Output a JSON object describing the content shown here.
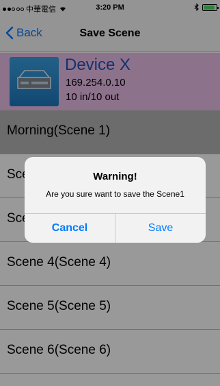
{
  "status_bar": {
    "carrier": "中華電信",
    "time": "3:20 PM",
    "battery_level": 0.9,
    "battery_color": "#4cd964"
  },
  "nav": {
    "back_label": "Back",
    "title": "Save Scene",
    "tint_color": "#007aff"
  },
  "device": {
    "name": "Device X",
    "ip": "169.254.0.10",
    "io": "10 in/10 out",
    "header_color": "#ebbee9",
    "name_color": "#2453b8"
  },
  "scenes": [
    {
      "label": "Morning(Scene 1)",
      "selected": true
    },
    {
      "label": "Scene 2(Scene 2)",
      "selected": false
    },
    {
      "label": "Scene 3(Scene 3)",
      "selected": false
    },
    {
      "label": "Scene 4(Scene 4)",
      "selected": false
    },
    {
      "label": "Scene 5(Scene 5)",
      "selected": false
    },
    {
      "label": "Scene 6(Scene 6)",
      "selected": false
    }
  ],
  "alert": {
    "title": "Warning!",
    "message": "Are you sure want to save the Scene1",
    "cancel_label": "Cancel",
    "confirm_label": "Save"
  }
}
